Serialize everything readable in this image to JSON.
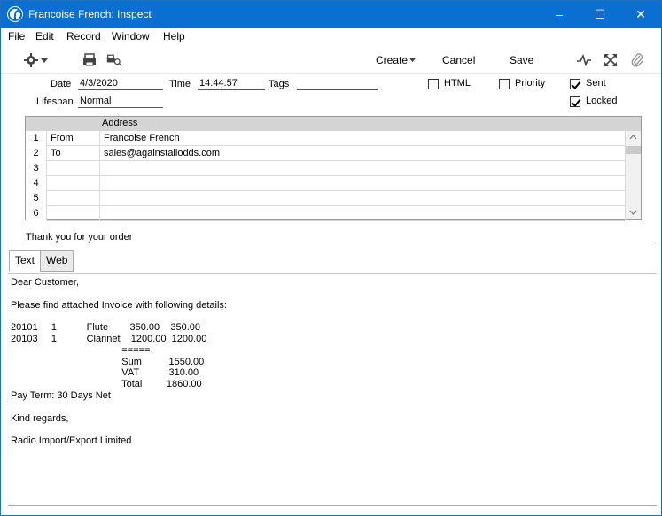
{
  "window": {
    "title": "Francoise French: Inspect",
    "controls": [
      "minimize-icon",
      "maximize-icon",
      "close-icon"
    ],
    "accent": "#0a6fd1"
  },
  "menubar": [
    "File",
    "Edit",
    "Record",
    "Window",
    "Help"
  ],
  "toolbar": {
    "create_label": "Create",
    "cancel_label": "Cancel",
    "save_label": "Save"
  },
  "header": {
    "date_label": "Date",
    "date_value": "4/3/2020",
    "time_label": "Time",
    "time_value": "14:44:57",
    "tags_label": "Tags",
    "tags_value": "",
    "lifespan_label": "Lifespan",
    "lifespan_value": "Normal",
    "html_label": "HTML",
    "html_checked": false,
    "priority_label": "Priority",
    "priority_checked": false,
    "sent_label": "Sent",
    "sent_checked": true,
    "locked_label": "Locked",
    "locked_checked": true
  },
  "address_grid": {
    "column_header": "Address",
    "rows": [
      {
        "num": "1",
        "type": "From",
        "address": "Francoise French"
      },
      {
        "num": "2",
        "type": "To",
        "address": "sales@againstallodds.com"
      },
      {
        "num": "3",
        "type": "",
        "address": ""
      },
      {
        "num": "4",
        "type": "",
        "address": ""
      },
      {
        "num": "5",
        "type": "",
        "address": ""
      },
      {
        "num": "6",
        "type": "",
        "address": ""
      }
    ]
  },
  "subject": "Thank you for your order",
  "tabs": [
    "Text",
    "Web"
  ],
  "body_lines": [
    "Dear Customer,",
    "",
    "Please find attached Invoice with following details:",
    "",
    "20101     1           Flute        350.00    350.00",
    "20103     1           Clarinet    1200.00  1200.00",
    "                                         =====",
    "                                         Sum          1550.00",
    "                                         VAT           310.00",
    "                                         Total         1860.00",
    "Pay Term: 30 Days Net",
    "",
    "Kind regards,",
    "",
    "Radio Import/Export Limited"
  ]
}
